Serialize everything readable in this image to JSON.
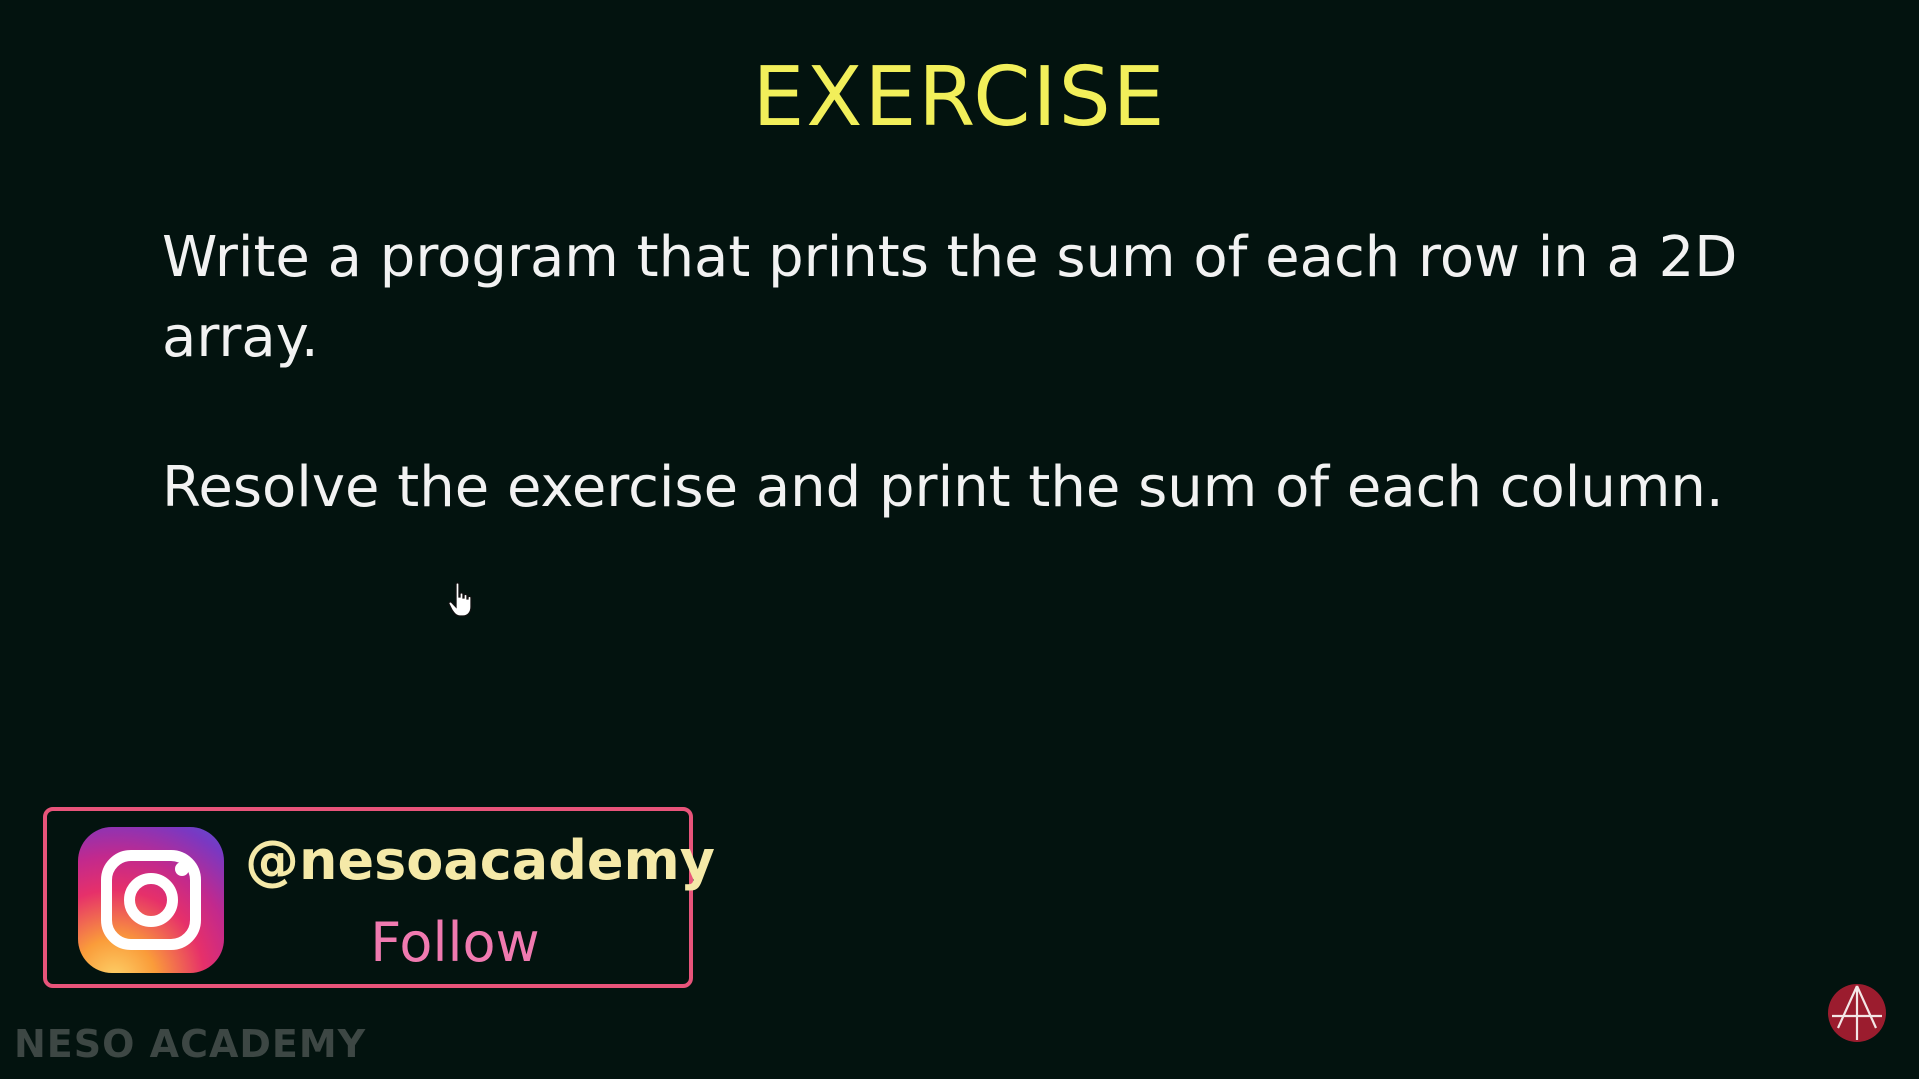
{
  "slide": {
    "title": "EXERCISE",
    "paragraph_1": "Write a program that prints the sum of each row in a 2D array.",
    "paragraph_2": "Resolve the exercise and print the sum of each column."
  },
  "instagram_promo": {
    "icon": "instagram-icon",
    "handle": "@nesoacademy",
    "action": "Follow"
  },
  "watermark": "NESO ACADEMY",
  "corner_logo": "neso-logo-icon",
  "colors": {
    "background": "#03130f",
    "title": "#f2ef5a",
    "body_text": "#f2f2f2",
    "promo_border": "#e8547a",
    "handle_text": "#f5e9a8",
    "follow_text": "#f07ab0",
    "logo": "#9b1c2e"
  }
}
